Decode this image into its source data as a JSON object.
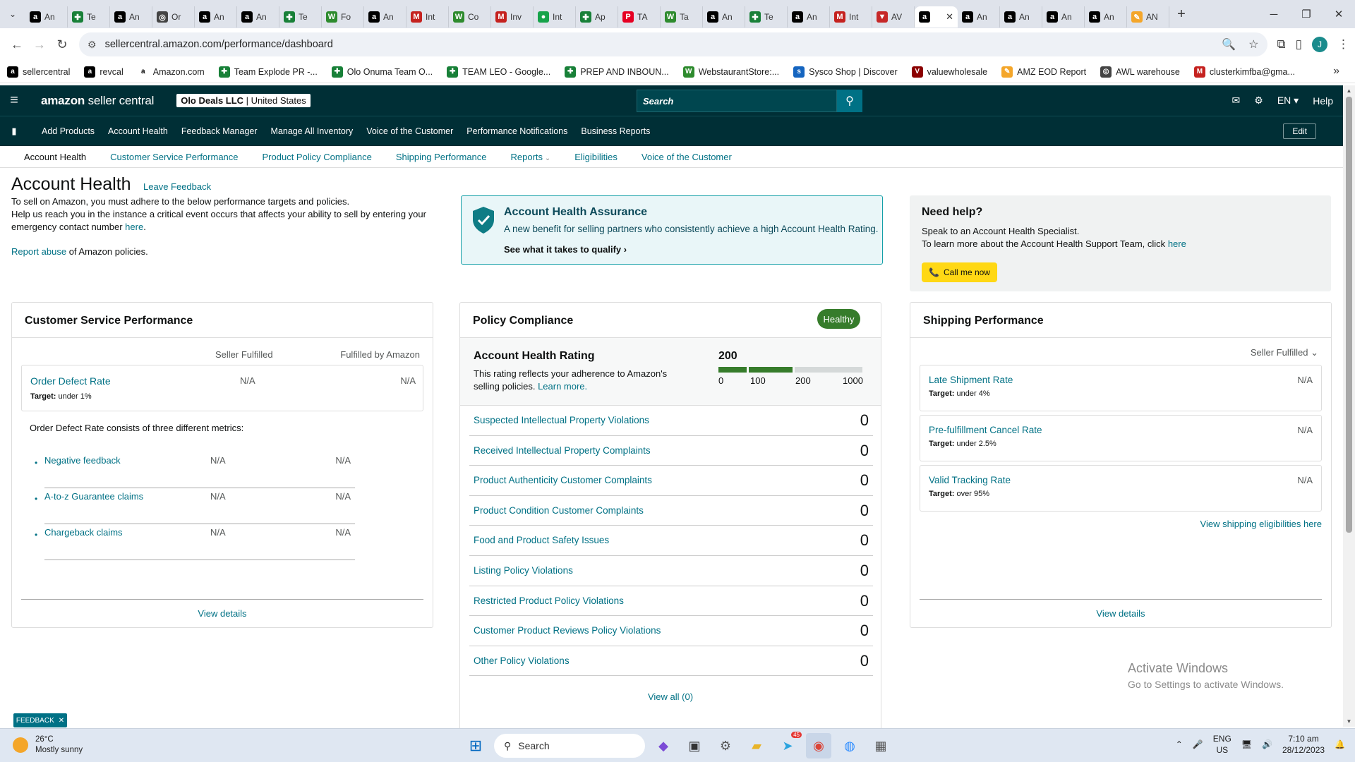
{
  "browser": {
    "tabs": [
      {
        "icon": "amazon-icon",
        "label": "An",
        "color": "#000000"
      },
      {
        "icon": "sheets-icon",
        "label": "Te",
        "color": "#188038"
      },
      {
        "icon": "amazon-icon",
        "label": "An",
        "color": "#000000"
      },
      {
        "icon": "globe-icon",
        "label": "Or",
        "color": "#444444"
      },
      {
        "icon": "amazon-icon",
        "label": "An",
        "color": "#000000"
      },
      {
        "icon": "amazon-icon",
        "label": "An",
        "color": "#000000"
      },
      {
        "icon": "sheets-icon",
        "label": "Te",
        "color": "#188038"
      },
      {
        "icon": "webstaurant-icon",
        "label": "Fo",
        "color": "#2e8b2e"
      },
      {
        "icon": "amazon-icon",
        "label": "An",
        "color": "#000000"
      },
      {
        "icon": "gmail-icon",
        "label": "Int",
        "color": "#c5221f"
      },
      {
        "icon": "webstaurant-icon",
        "label": "Co",
        "color": "#2e8b2e"
      },
      {
        "icon": "gmail-icon",
        "label": "Inv",
        "color": "#c5221f"
      },
      {
        "icon": "chat-icon",
        "label": "Int",
        "color": "#16a34a"
      },
      {
        "icon": "sheets-icon",
        "label": "Ap",
        "color": "#188038"
      },
      {
        "icon": "pinterest-icon",
        "label": "TA",
        "color": "#e60023"
      },
      {
        "icon": "webstaurant-icon",
        "label": "Ta",
        "color": "#2e8b2e"
      },
      {
        "icon": "amazon-icon",
        "label": "An",
        "color": "#000000"
      },
      {
        "icon": "sheets-icon",
        "label": "Te",
        "color": "#188038"
      },
      {
        "icon": "amazon-icon",
        "label": "An",
        "color": "#000000"
      },
      {
        "icon": "gmail-icon",
        "label": "Int",
        "color": "#c5221f"
      },
      {
        "icon": "awl-icon",
        "label": "AV",
        "color": "#c62828"
      },
      {
        "icon": "amazon-icon",
        "label": "",
        "color": "#000000",
        "active": true
      },
      {
        "icon": "amazon-icon",
        "label": "An",
        "color": "#000000"
      },
      {
        "icon": "amazon-icon",
        "label": "An",
        "color": "#000000"
      },
      {
        "icon": "amazon-icon",
        "label": "An",
        "color": "#000000"
      },
      {
        "icon": "amazon-icon",
        "label": "An",
        "color": "#000000"
      },
      {
        "icon": "amz-eod-icon",
        "label": "AN",
        "color": "#f4a62a"
      }
    ],
    "url": "sellercentral.amazon.com/performance/dashboard",
    "profile_initial": "J",
    "bookmarks": [
      {
        "icon": "amazon-icon",
        "label": "sellercentral",
        "color": "#000000"
      },
      {
        "icon": "amazon-icon",
        "label": "revcal",
        "color": "#000000"
      },
      {
        "icon": "amazon-smile-icon",
        "label": "Amazon.com",
        "color": "#ffffff"
      },
      {
        "icon": "sheets-icon",
        "label": "Team Explode PR -...",
        "color": "#188038"
      },
      {
        "icon": "sheets-icon",
        "label": "Olo Onuma Team O...",
        "color": "#188038"
      },
      {
        "icon": "sheets-icon",
        "label": "TEAM LEO - Google...",
        "color": "#188038"
      },
      {
        "icon": "sheets-icon",
        "label": "PREP AND INBOUN...",
        "color": "#188038"
      },
      {
        "icon": "webstaurant-icon",
        "label": "WebstaurantStore:...",
        "color": "#2e8b2e"
      },
      {
        "icon": "sysco-icon",
        "label": "Sysco Shop | Discover",
        "color": "#1565c0"
      },
      {
        "icon": "valuewholesale-icon",
        "label": "valuewholesale",
        "color": "#8b0000"
      },
      {
        "icon": "amz-eod-icon",
        "label": "AMZ EOD Report",
        "color": "#f4a62a"
      },
      {
        "icon": "globe-icon",
        "label": "AWL warehouse",
        "color": "#444444"
      },
      {
        "icon": "gmail-icon",
        "label": "clusterkimfba@gma...",
        "color": "#c5221f"
      }
    ]
  },
  "header": {
    "logo_main": "amazon",
    "logo_sub": "seller central",
    "account_name": "Olo Deals LLC",
    "account_region": "United States",
    "search_placeholder": "Search",
    "lang": "EN",
    "help": "Help",
    "nav": [
      "Add Products",
      "Account Health",
      "Feedback Manager",
      "Manage All Inventory",
      "Voice of the Customer",
      "Performance Notifications",
      "Business Reports"
    ],
    "edit": "Edit",
    "subnav": [
      "Account Health",
      "Customer Service Performance",
      "Product Policy Compliance",
      "Shipping Performance",
      "Reports",
      "Eligibilities",
      "Voice of the Customer"
    ]
  },
  "page": {
    "title": "Account Health",
    "leave_feedback": "Leave Feedback",
    "intro_1": "To sell on Amazon, you must adhere to the below performance targets and policies.",
    "intro_2": "Help us reach you in the instance a critical event occurs that affects your ability to sell by entering your emergency contact number",
    "intro_2_link": "here",
    "report_abuse_link": "Report abuse",
    "report_abuse_text": "of Amazon policies."
  },
  "assurance": {
    "title": "Account Health Assurance",
    "text": "A new benefit for selling partners who consistently achieve a high Account Health Rating.",
    "cta": "See what it takes to qualify",
    "accent": "#14a0a8"
  },
  "help": {
    "title": "Need help?",
    "line1": "Speak to an Account Health Specialist.",
    "line2": "To learn more about the Account Health Support Team, click",
    "line2_link": "here",
    "call": "Call me now"
  },
  "customer_service": {
    "title": "Customer Service Performance",
    "col_seller": "Seller Fulfilled",
    "col_fba": "Fulfilled by Amazon",
    "odr": {
      "name": "Order Defect Rate",
      "target_label": "Target:",
      "target": "under 1%",
      "seller": "N/A",
      "fba": "N/A"
    },
    "desc": "Order Defect Rate consists of three different metrics:",
    "metrics": [
      {
        "name": "Negative feedback",
        "seller": "N/A",
        "fba": "N/A"
      },
      {
        "name": "A-to-z Guarantee claims",
        "seller": "N/A",
        "fba": "N/A"
      },
      {
        "name": "Chargeback claims",
        "seller": "N/A",
        "fba": "N/A"
      }
    ],
    "view_details": "View details"
  },
  "policy": {
    "title": "Policy Compliance",
    "status": "Healthy",
    "status_color": "#367c2b",
    "ahr_title": "Account Health Rating",
    "ahr_desc": "This rating reflects your adherence to Amazon's selling policies.",
    "ahr_link": "Learn more.",
    "score": "200",
    "ticks": [
      "0",
      "100",
      "200",
      "1000"
    ],
    "rows": [
      {
        "label": "Suspected Intellectual Property Violations",
        "value": "0"
      },
      {
        "label": "Received Intellectual Property Complaints",
        "value": "0"
      },
      {
        "label": "Product Authenticity Customer Complaints",
        "value": "0"
      },
      {
        "label": "Product Condition Customer Complaints",
        "value": "0"
      },
      {
        "label": "Food and Product Safety Issues",
        "value": "0"
      },
      {
        "label": "Listing Policy Violations",
        "value": "0"
      },
      {
        "label": "Restricted Product Policy Violations",
        "value": "0"
      },
      {
        "label": "Customer Product Reviews Policy Violations",
        "value": "0"
      },
      {
        "label": "Other Policy Violations",
        "value": "0"
      }
    ],
    "view_all": "View all (0)"
  },
  "shipping": {
    "title": "Shipping Performance",
    "filter": "Seller Fulfilled",
    "items": [
      {
        "name": "Late Shipment Rate",
        "target_label": "Target:",
        "target": "under 4%",
        "value": "N/A"
      },
      {
        "name": "Pre-fulfillment Cancel Rate",
        "target_label": "Target:",
        "target": "under 2.5%",
        "value": "N/A"
      },
      {
        "name": "Valid Tracking Rate",
        "target_label": "Target:",
        "target": "over 95%",
        "value": "N/A"
      }
    ],
    "eligibilities": "View shipping eligibilities here",
    "view_details": "View details"
  },
  "windows": {
    "activate_1": "Activate Windows",
    "activate_2": "Go to Settings to activate Windows.",
    "feedback_tab": "FEEDBACK",
    "weather_temp": "26°C",
    "weather_desc": "Mostly sunny",
    "search": "Search",
    "lang_1": "ENG",
    "lang_2": "US",
    "time": "7:10 am",
    "date": "28/12/2023",
    "telegram_badge": "45"
  }
}
